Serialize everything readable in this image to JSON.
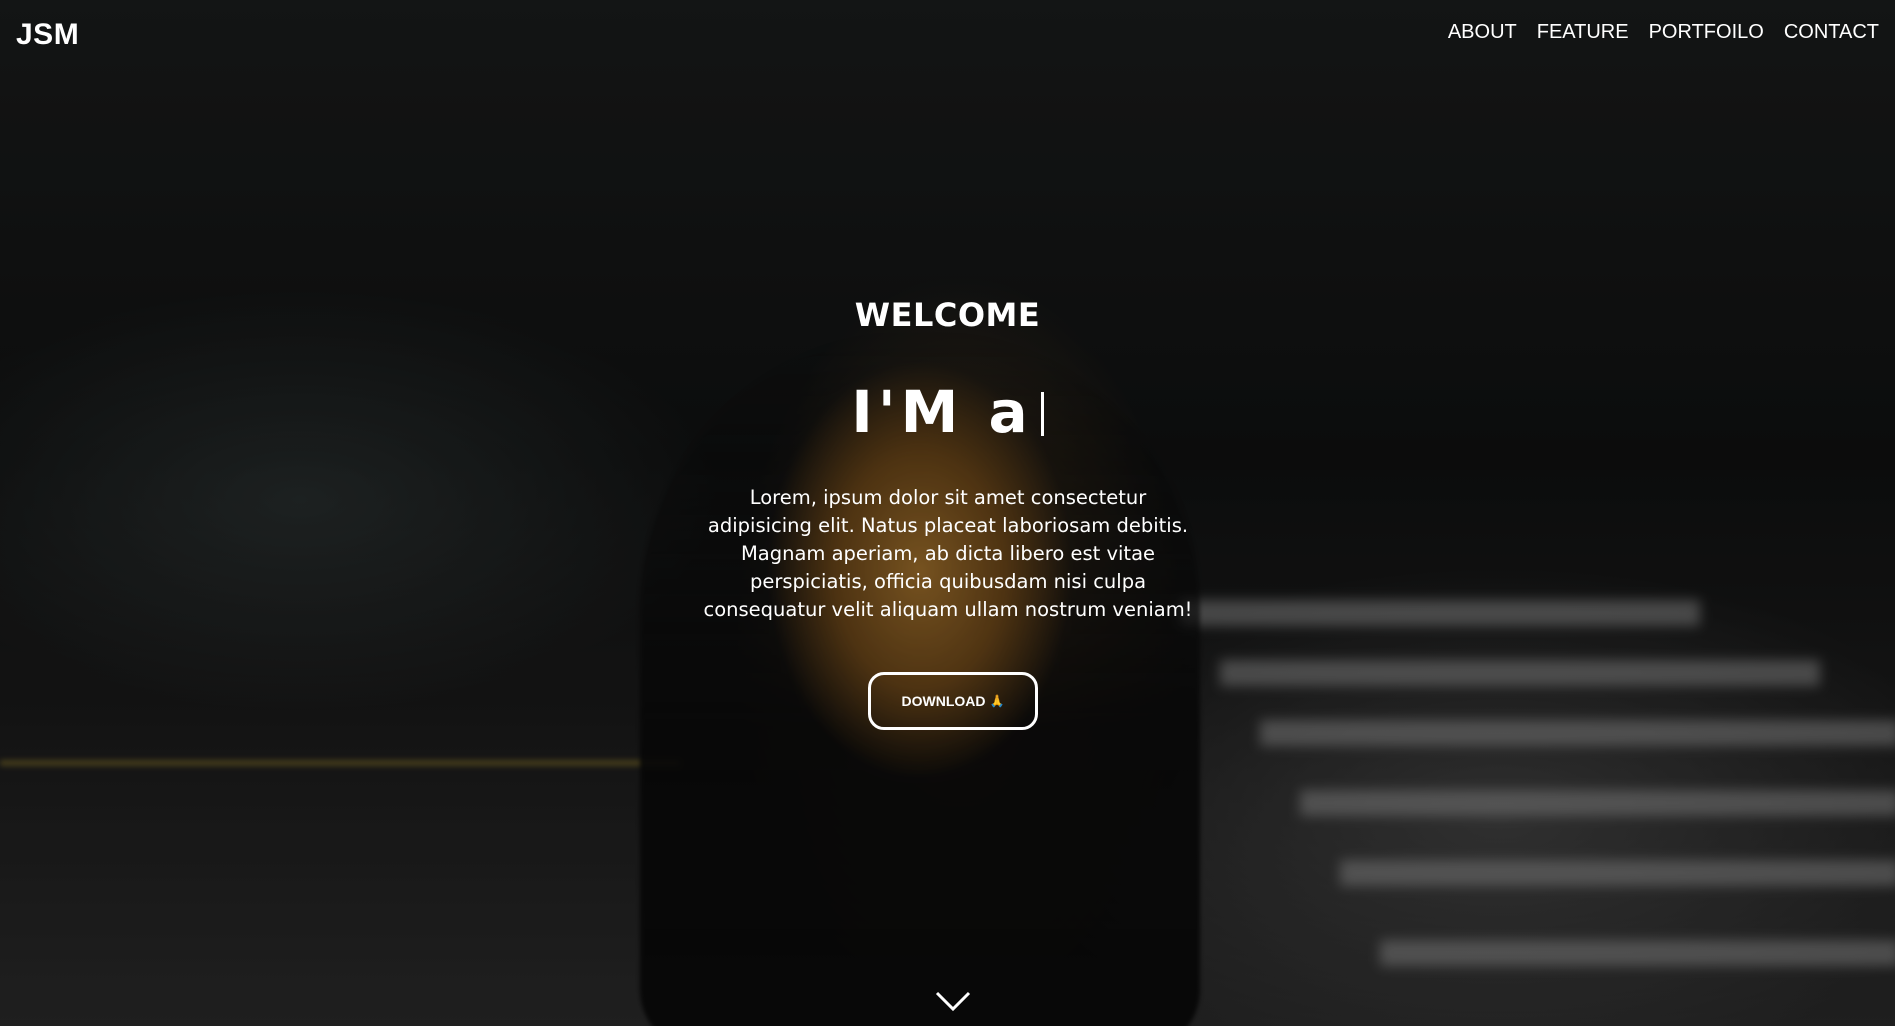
{
  "header": {
    "logo": "JSM",
    "nav": [
      {
        "label": "ABOUT"
      },
      {
        "label": "FEATURE"
      },
      {
        "label": "PORTFOILO"
      },
      {
        "label": "CONTACT"
      }
    ]
  },
  "hero": {
    "welcome": "WELCOME",
    "typed_text": "I'M a",
    "description": "Lorem, ipsum dolor sit amet consectetur adipisicing elit. Natus placeat laboriosam debitis. Magnam aperiam, ab dicta libero est vitae perspiciatis, officia quibusdam nisi culpa consequatur velit aliquam ullam nostrum veniam!",
    "button_label": "DOWNLOAD",
    "button_emoji": "🙏",
    "scroll_icon": "chevron-down-icon"
  },
  "colors": {
    "text": "#ffffff",
    "background": "#0e0e0e"
  }
}
